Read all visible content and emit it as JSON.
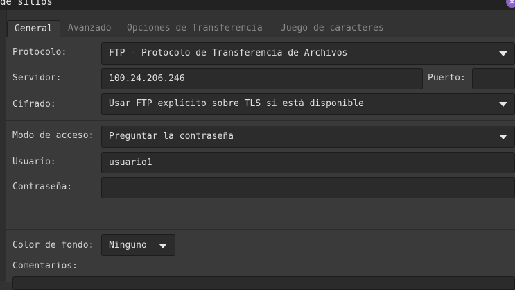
{
  "window": {
    "title": "de sitios",
    "close_glyph": "×"
  },
  "tabs": [
    {
      "label": "General",
      "active": true
    },
    {
      "label": "Avanzado",
      "active": false
    },
    {
      "label": "Opciones de Transferencia",
      "active": false
    },
    {
      "label": "Juego de caracteres",
      "active": false
    }
  ],
  "form": {
    "protocol_label": "Protocolo:",
    "protocol_value": "FTP - Protocolo de Transferencia de Archivos",
    "server_label": "Servidor:",
    "server_value": "100.24.206.246",
    "port_label": "Puerto:",
    "port_value": "",
    "encryption_label": "Cifrado:",
    "encryption_value": "Usar FTP explícito sobre TLS si está disponible",
    "access_label": "Modo de acceso:",
    "access_value": "Preguntar la contraseña",
    "user_label": "Usuario:",
    "user_value": "usuario1",
    "password_label": "Contraseña:",
    "password_value": "",
    "bgcolor_label": "Color de fondo:",
    "bgcolor_value": "Ninguno",
    "comments_label": "Comentarios:",
    "comments_value": ""
  },
  "icons": {
    "close": "close-icon",
    "dropdown": "chevron-down-icon"
  },
  "colors": {
    "accent": "#8a62c9",
    "background": "#3a3a3a",
    "field": "#2b2b2b"
  }
}
